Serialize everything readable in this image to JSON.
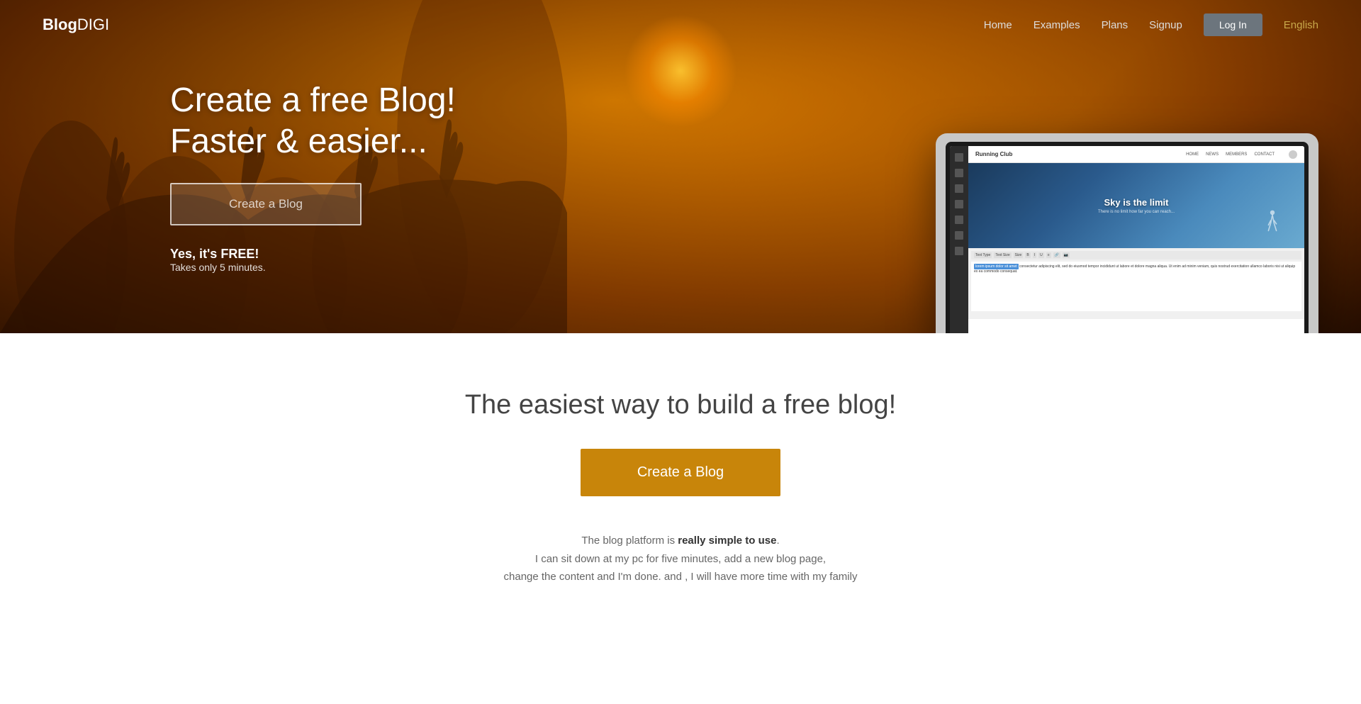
{
  "brand": {
    "name_bold": "Blog",
    "name_thin": "DIGI"
  },
  "nav": {
    "links": [
      {
        "label": "Home",
        "id": "home"
      },
      {
        "label": "Examples",
        "id": "examples"
      },
      {
        "label": "Plans",
        "id": "plans"
      },
      {
        "label": "Signup",
        "id": "signup"
      }
    ],
    "login_label": "Log In",
    "language_label": "English"
  },
  "hero": {
    "title_line1": "Create a free Blog!",
    "title_line2": "Faster & easier...",
    "cta_label": "Create a Blog",
    "free_label": "Yes, it's FREE!",
    "free_sub": "Takes only 5 minutes."
  },
  "laptop_screen": {
    "site_name": "Running Club",
    "nav_items": [
      "HOME",
      "NEWS",
      "MEMBERS",
      "CONTACT"
    ],
    "hero_title": "Sky is the limit",
    "hero_sub": "There is no limit how far you can reach...",
    "editor_highlight": "lorem ipsum dolor sit amet",
    "editor_body": "consectetur adipiscing elit, sed do eiusmod tempor incididunt ut labore et dolore magna aliqua. Ut enim ad minim veniam, quis nostrud exercitation ullamco laboris nisi ut aliquip ex ea commodo consequat."
  },
  "section2": {
    "tagline": "The easiest way to build a free blog!",
    "cta_label": "Create a Blog",
    "desc_part1": "The blog platform is ",
    "desc_bold": "really simple to use",
    "desc_part2": ".",
    "desc_line2": "I can sit down at my pc for five minutes, add a new blog page,",
    "desc_line3": "change the content and I'm done. and , I will have more time with my family"
  }
}
